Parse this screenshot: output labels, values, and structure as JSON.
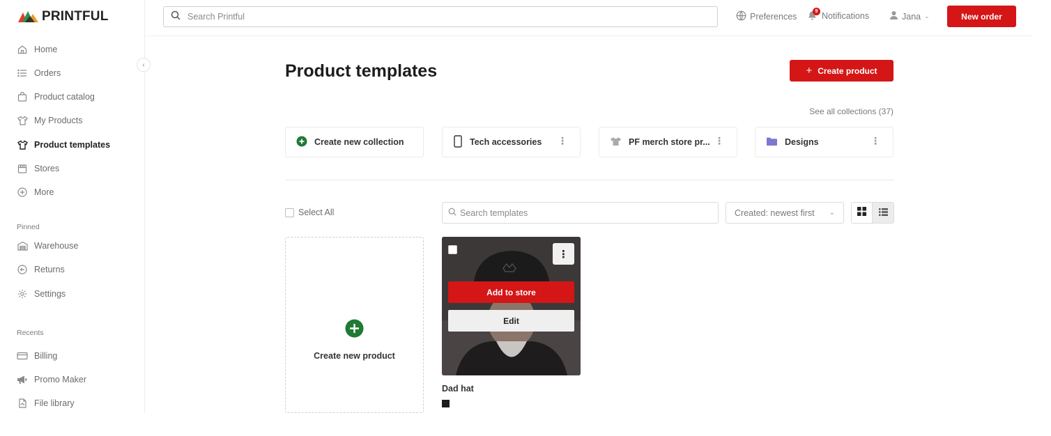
{
  "brand": {
    "name": "PRINTFUL",
    "accent": "#d41616"
  },
  "topbar": {
    "search_placeholder": "Search Printful",
    "preferences": "Preferences",
    "notifications": "Notifications",
    "notification_count": "9",
    "user": "Jana",
    "new_order": "New order"
  },
  "sidebar": {
    "items": [
      {
        "label": "Home",
        "icon": "home-icon"
      },
      {
        "label": "Orders",
        "icon": "list-icon"
      },
      {
        "label": "Product catalog",
        "icon": "bag-icon"
      },
      {
        "label": "My Products",
        "icon": "shirt-icon"
      },
      {
        "label": "Product templates",
        "icon": "shirt-icon",
        "active": true
      },
      {
        "label": "Stores",
        "icon": "store-icon"
      },
      {
        "label": "More",
        "icon": "plus-circle-icon"
      }
    ],
    "pinned_label": "Pinned",
    "pinned": [
      {
        "label": "Warehouse",
        "icon": "warehouse-icon"
      },
      {
        "label": "Returns",
        "icon": "return-icon"
      },
      {
        "label": "Settings",
        "icon": "gear-icon"
      }
    ],
    "recents_label": "Recents",
    "recents": [
      {
        "label": "Billing",
        "icon": "card-icon"
      },
      {
        "label": "Promo Maker",
        "icon": "megaphone-icon"
      },
      {
        "label": "File library",
        "icon": "file-icon"
      }
    ]
  },
  "main": {
    "title": "Product templates",
    "create_product": "Create product",
    "see_all": "See all collections (37)",
    "collections": [
      {
        "label": "Create new collection",
        "icon": "plus-circle-icon"
      },
      {
        "label": "Tech accessories",
        "icon": "phone-icon"
      },
      {
        "label": "PF merch store pr...",
        "icon": "shirt-icon"
      },
      {
        "label": "Designs",
        "icon": "folder-icon"
      }
    ],
    "select_all": "Select All",
    "search_templates_placeholder": "Search templates",
    "sort": "Created: newest first",
    "new_product": "Create new product",
    "product": {
      "name": "Dad hat",
      "add_to_store": "Add to store",
      "edit": "Edit",
      "swatch_color": "#1c1c1c"
    }
  }
}
